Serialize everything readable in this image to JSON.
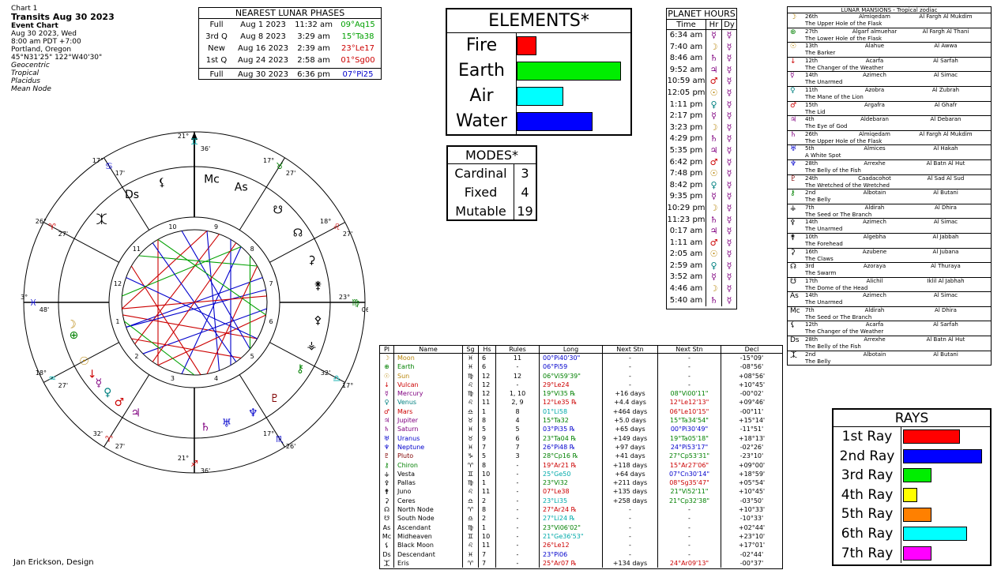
{
  "header": {
    "chart_label": "Chart 1",
    "title": "Transits Aug 30 2023",
    "chart_type": "Event Chart",
    "date": "Aug 30 2023, Wed",
    "time": "8:00 am  PDT +7:00",
    "place": "Portland, Oregon",
    "coords": "45°N31'25\"  122°W40'30\"",
    "settings": [
      "Geocentric",
      "Tropical",
      "Placidus",
      "Mean Node"
    ]
  },
  "lunar_phases": {
    "title": "NEAREST LUNAR PHASES",
    "rows": [
      {
        "phase": "Full",
        "date": "Aug 1 2023",
        "time": "11:32 am",
        "pos": "09°Aq15",
        "color": "#00a000"
      },
      {
        "phase": "3rd Q",
        "date": "Aug 8 2023",
        "time": "3:29 am",
        "pos": "15°Ta38",
        "color": "#00a000"
      },
      {
        "phase": "New",
        "date": "Aug 16 2023",
        "time": "2:39 am",
        "pos": "23°Le17",
        "color": "#cc0000"
      },
      {
        "phase": "1st Q",
        "date": "Aug 24 2023",
        "time": "2:58 am",
        "pos": "01°Sg00",
        "color": "#cc0000"
      },
      {
        "phase": "Full",
        "date": "Aug 30 2023",
        "time": "6:36 pm",
        "pos": "07°Pi25",
        "color": "#0000cc"
      }
    ]
  },
  "elements": {
    "title": "ELEMENTS*",
    "items": [
      {
        "label": "Fire",
        "value": 0.19,
        "color": "#ff0000"
      },
      {
        "label": "Earth",
        "value": 1.0,
        "color": "#00ee00"
      },
      {
        "label": "Air",
        "value": 0.45,
        "color": "#00ffff"
      },
      {
        "label": "Water",
        "value": 0.73,
        "color": "#0000ff"
      }
    ]
  },
  "modes": {
    "title": "MODES*",
    "items": [
      {
        "label": "Cardinal",
        "value": "3"
      },
      {
        "label": "Fixed",
        "value": "4"
      },
      {
        "label": "Mutable",
        "value": "19"
      }
    ]
  },
  "planet_hours": {
    "title": "PLANET HOURS",
    "headers": [
      "Time",
      "Hr",
      "Dy"
    ],
    "rows": [
      {
        "time": "6:34 am",
        "hr": "☿",
        "hc": "#800080",
        "dy": "☿",
        "dc": "#800080"
      },
      {
        "time": "7:40 am",
        "hr": "☽",
        "hc": "#b8860b",
        "dy": "☿",
        "dc": "#800080"
      },
      {
        "time": "8:46 am",
        "hr": "♄",
        "hc": "#800080",
        "dy": "☿",
        "dc": "#800080"
      },
      {
        "time": "9:52 am",
        "hr": "♃",
        "hc": "#800080",
        "dy": "☿",
        "dc": "#800080"
      },
      {
        "time": "10:59 am",
        "hr": "♂",
        "hc": "#cc0000",
        "dy": "☿",
        "dc": "#800080"
      },
      {
        "time": "12:05 pm",
        "hr": "☉",
        "hc": "#b8860b",
        "dy": "☿",
        "dc": "#800080"
      },
      {
        "time": "1:11 pm",
        "hr": "♀",
        "hc": "#008080",
        "dy": "☿",
        "dc": "#800080"
      },
      {
        "time": "2:17 pm",
        "hr": "☿",
        "hc": "#800080",
        "dy": "☿",
        "dc": "#800080"
      },
      {
        "time": "3:23 pm",
        "hr": "☽",
        "hc": "#b8860b",
        "dy": "☿",
        "dc": "#800080"
      },
      {
        "time": "4:29 pm",
        "hr": "♄",
        "hc": "#800080",
        "dy": "☿",
        "dc": "#800080"
      },
      {
        "time": "5:35 pm",
        "hr": "♃",
        "hc": "#800080",
        "dy": "☿",
        "dc": "#800080"
      },
      {
        "time": "6:42 pm",
        "hr": "♂",
        "hc": "#cc0000",
        "dy": "☿",
        "dc": "#800080"
      },
      {
        "time": "7:48 pm",
        "hr": "☉",
        "hc": "#b8860b",
        "dy": "☿",
        "dc": "#800080"
      },
      {
        "time": "8:42 pm",
        "hr": "♀",
        "hc": "#008080",
        "dy": "☿",
        "dc": "#800080"
      },
      {
        "time": "9:35 pm",
        "hr": "☿",
        "hc": "#800080",
        "dy": "☿",
        "dc": "#800080"
      },
      {
        "time": "10:29 pm",
        "hr": "☽",
        "hc": "#b8860b",
        "dy": "☿",
        "dc": "#800080"
      },
      {
        "time": "11:23 pm",
        "hr": "♄",
        "hc": "#800080",
        "dy": "☿",
        "dc": "#800080"
      },
      {
        "time": "0:17 am",
        "hr": "♃",
        "hc": "#800080",
        "dy": "☿",
        "dc": "#800080"
      },
      {
        "time": "1:11 am",
        "hr": "♂",
        "hc": "#cc0000",
        "dy": "☿",
        "dc": "#800080"
      },
      {
        "time": "2:05 am",
        "hr": "☉",
        "hc": "#b8860b",
        "dy": "☿",
        "dc": "#800080"
      },
      {
        "time": "2:59 am",
        "hr": "♀",
        "hc": "#008080",
        "dy": "☿",
        "dc": "#800080"
      },
      {
        "time": "3:52 am",
        "hr": "☿",
        "hc": "#800080",
        "dy": "☿",
        "dc": "#800080"
      },
      {
        "time": "4:46 am",
        "hr": "☽",
        "hc": "#b8860b",
        "dy": "☿",
        "dc": "#800080"
      },
      {
        "time": "5:40 am",
        "hr": "♄",
        "hc": "#800080",
        "dy": "☿",
        "dc": "#800080"
      }
    ]
  },
  "mansions": {
    "title": "LUNAR MANSIONS - Tropical zodiac",
    "rows": [
      {
        "g": "☽",
        "gc": "#b8860b",
        "num": "26th",
        "n1": "Almiqedam",
        "n2": "Al Fargh Al Mukdim",
        "desc": "The Upper Hole of the Flask"
      },
      {
        "g": "⊕",
        "gc": "#008000",
        "num": "27th",
        "n1": "Algarf almuehar",
        "n2": "Al Fargh Al Thani",
        "desc": "The Lower Hole of the Flask"
      },
      {
        "g": "☉",
        "gc": "#b8860b",
        "num": "13th",
        "n1": "Alahue",
        "n2": "Al Awwa",
        "desc": "The Barker"
      },
      {
        "g": "↓",
        "gc": "#cc0000",
        "num": "12th",
        "n1": "Acarfa",
        "n2": "Al Sarfah",
        "desc": "The Changer of the Weather"
      },
      {
        "g": "☿",
        "gc": "#800080",
        "num": "14th",
        "n1": "Azimech",
        "n2": "Al Simac",
        "desc": "The Unarmed"
      },
      {
        "g": "♀",
        "gc": "#008080",
        "num": "11th",
        "n1": "Azobra",
        "n2": "Al Zubrah",
        "desc": "The Mane of the Lion"
      },
      {
        "g": "♂",
        "gc": "#cc0000",
        "num": "15th",
        "n1": "Argafra",
        "n2": "Al Ghafr",
        "desc": "The Lid"
      },
      {
        "g": "♃",
        "gc": "#800080",
        "num": "4th",
        "n1": "Aldebaran",
        "n2": "Al Debaran",
        "desc": "The Eye of God"
      },
      {
        "g": "♄",
        "gc": "#800080",
        "num": "26th",
        "n1": "Almiqedam",
        "n2": "Al Fargh Al Mukdim",
        "desc": "The Upper Hole of the Flask"
      },
      {
        "g": "♅",
        "gc": "#0000cc",
        "num": "5th",
        "n1": "Almices",
        "n2": "Al Hakah",
        "desc": "A White Spot"
      },
      {
        "g": "♆",
        "gc": "#0000cc",
        "num": "28th",
        "n1": "Arrexhe",
        "n2": "Al Batn Al Hut",
        "desc": "The Belly of the Fish"
      },
      {
        "g": "♇",
        "gc": "#800000",
        "num": "24th",
        "n1": "Caadacohot",
        "n2": "Al Sad Al Sud",
        "desc": "The Wretched of the Wretched"
      },
      {
        "g": "⚷",
        "gc": "#008000",
        "num": "2nd",
        "n1": "Albotain",
        "n2": "Al Butani",
        "desc": "The Belly"
      },
      {
        "g": "⚶",
        "gc": "#000000",
        "num": "7th",
        "n1": "Aldirah",
        "n2": "Al Dhira",
        "desc": "The Seed or The Branch"
      },
      {
        "g": "⚴",
        "gc": "#000000",
        "num": "14th",
        "n1": "Azimech",
        "n2": "Al Simac",
        "desc": "The Unarmed"
      },
      {
        "g": "⚵",
        "gc": "#000000",
        "num": "10th",
        "n1": "Algebha",
        "n2": "Al Jabbah",
        "desc": "The Forehead"
      },
      {
        "g": "⚳",
        "gc": "#000000",
        "num": "16th",
        "n1": "Azubene",
        "n2": "Al Jubana",
        "desc": "The Claws"
      },
      {
        "g": "☊",
        "gc": "#000000",
        "num": "3rd",
        "n1": "Azoraya",
        "n2": "Al Thuraya",
        "desc": "The Swarm"
      },
      {
        "g": "☋",
        "gc": "#000000",
        "num": "17th",
        "n1": "Alichil",
        "n2": "Iklil Al Jabhah",
        "desc": "The Dome of the Head"
      },
      {
        "g": "As",
        "gc": "#000000",
        "num": "14th",
        "n1": "Azimech",
        "n2": "Al Simac",
        "desc": "The Unarmed"
      },
      {
        "g": "Mc",
        "gc": "#000000",
        "num": "7th",
        "n1": "Aldirah",
        "n2": "Al Dhira",
        "desc": "The Seed or The Branch"
      },
      {
        "g": "⚸",
        "gc": "#000000",
        "num": "12th",
        "n1": "Acarfa",
        "n2": "Al Sarfah",
        "desc": "The Changer of the Weather"
      },
      {
        "g": "Ds",
        "gc": "#000000",
        "num": "28th",
        "n1": "Arrexhe",
        "n2": "Al Batn Al Hut",
        "desc": "The Belly of the Fish"
      },
      {
        "g": "⯰",
        "gc": "#000000",
        "num": "2nd",
        "n1": "Albotain",
        "n2": "Al Butani",
        "desc": "The Belly"
      }
    ]
  },
  "rays": {
    "title": "RAYS",
    "items": [
      {
        "label": "1st Ray",
        "value": 0.72,
        "color": "#ff0000"
      },
      {
        "label": "2nd Ray",
        "value": 1.0,
        "color": "#0000ff"
      },
      {
        "label": "3rd Ray",
        "value": 0.36,
        "color": "#00ee00"
      },
      {
        "label": "4th Ray",
        "value": 0.18,
        "color": "#ffff00"
      },
      {
        "label": "5th Ray",
        "value": 0.36,
        "color": "#ff8000"
      },
      {
        "label": "6th Ray",
        "value": 0.81,
        "color": "#00ffff"
      },
      {
        "label": "7th Ray",
        "value": 0.36,
        "color": "#ff00ff"
      }
    ]
  },
  "planet_table": {
    "headers": [
      "Pl",
      "Name",
      "Sg",
      "Hs",
      "Rules",
      "Long",
      "Next Stn",
      "Next Stn",
      "Decl"
    ],
    "rows": [
      {
        "g": "☽",
        "gc": "#b8860b",
        "name": "Moon",
        "nc": "#b8860b",
        "sg": "♓",
        "hs": "6",
        "rules": "11",
        "long": "00°Pi40'30\"",
        "lc": "#0000cc",
        "n1": "-",
        "n2": "-",
        "n2c": "#000",
        "decl": "-15°09'"
      },
      {
        "g": "⊕",
        "gc": "#008000",
        "name": "Earth",
        "nc": "#008000",
        "sg": "♓",
        "hs": "6",
        "rules": "-",
        "long": "06°Pi59",
        "lc": "#0000cc",
        "n1": "-",
        "n2": "-",
        "n2c": "#000",
        "decl": "-08°56'"
      },
      {
        "g": "☉",
        "gc": "#b8860b",
        "name": "Sun",
        "nc": "#b8860b",
        "sg": "♍",
        "hs": "12",
        "rules": "12",
        "long": "06°Vi59'39\"",
        "lc": "#008000",
        "n1": "-",
        "n2": "-",
        "n2c": "#000",
        "decl": "+08°56'"
      },
      {
        "g": "↓",
        "gc": "#cc0000",
        "name": "Vulcan",
        "nc": "#cc0000",
        "sg": "♌",
        "hs": "12",
        "rules": "-",
        "long": "29°Le24",
        "lc": "#cc0000",
        "n1": "-",
        "n2": "-",
        "n2c": "#000",
        "decl": "+10°45'"
      },
      {
        "g": "☿",
        "gc": "#800080",
        "name": "Mercury",
        "nc": "#800080",
        "sg": "♍",
        "hs": "12",
        "rules": "1, 10",
        "long": "19°Vi35 ℞",
        "lc": "#008000",
        "n1": "+16 days",
        "n2": "08°Vi00'11\"",
        "n2c": "#008000",
        "decl": "-00°02'"
      },
      {
        "g": "♀",
        "gc": "#008080",
        "name": "Venus",
        "nc": "#008080",
        "sg": "♌",
        "hs": "11",
        "rules": "2, 9",
        "long": "12°Le35 ℞",
        "lc": "#cc0000",
        "n1": "+4.4 days",
        "n2": "12°Le12'13\"",
        "n2c": "#cc0000",
        "decl": "+09°46'"
      },
      {
        "g": "♂",
        "gc": "#cc0000",
        "name": "Mars",
        "nc": "#cc0000",
        "sg": "♎",
        "hs": "1",
        "rules": "8",
        "long": "01°Li58",
        "lc": "#00aaaa",
        "n1": "+464 days",
        "n2": "06°Le10'15\"",
        "n2c": "#cc0000",
        "decl": "-00°11'"
      },
      {
        "g": "♃",
        "gc": "#800080",
        "name": "Jupiter",
        "nc": "#800080",
        "sg": "♉",
        "hs": "8",
        "rules": "4",
        "long": "15°Ta32",
        "lc": "#008000",
        "n1": "+5.0 days",
        "n2": "15°Ta34'54\"",
        "n2c": "#008000",
        "decl": "+15°14'"
      },
      {
        "g": "♄",
        "gc": "#800080",
        "name": "Saturn",
        "nc": "#800080",
        "sg": "♓",
        "hs": "5",
        "rules": "5",
        "long": "03°Pi35 ℞",
        "lc": "#0000cc",
        "n1": "+65 days",
        "n2": "00°Pi30'49\"",
        "n2c": "#0000cc",
        "decl": "-11°51'"
      },
      {
        "g": "♅",
        "gc": "#0000cc",
        "name": "Uranus",
        "nc": "#0000cc",
        "sg": "♉",
        "hs": "9",
        "rules": "6",
        "long": "23°Ta04 ℞",
        "lc": "#008000",
        "n1": "+149 days",
        "n2": "19°Ta05'18\"",
        "n2c": "#008000",
        "decl": "+18°13'"
      },
      {
        "g": "♆",
        "gc": "#0000cc",
        "name": "Neptune",
        "nc": "#0000cc",
        "sg": "♓",
        "hs": "7",
        "rules": "7",
        "long": "26°Pi48 ℞",
        "lc": "#0000cc",
        "n1": "+97 days",
        "n2": "24°Pi53'17\"",
        "n2c": "#0000cc",
        "decl": "-02°26'"
      },
      {
        "g": "♇",
        "gc": "#800000",
        "name": "Pluto",
        "nc": "#800000",
        "sg": "♑",
        "hs": "5",
        "rules": "3",
        "long": "28°Cp16 ℞",
        "lc": "#008000",
        "n1": "+41 days",
        "n2": "27°Cp53'31\"",
        "n2c": "#008000",
        "decl": "-23°10'"
      },
      {
        "g": "⚷",
        "gc": "#008000",
        "name": "Chiron",
        "nc": "#008000",
        "sg": "♈",
        "hs": "8",
        "rules": "-",
        "long": "19°Ar21 ℞",
        "lc": "#cc0000",
        "n1": "+118 days",
        "n2": "15°Ar27'06\"",
        "n2c": "#cc0000",
        "decl": "+09°00'"
      },
      {
        "g": "⚶",
        "gc": "#000000",
        "name": "Vesta",
        "nc": "#000000",
        "sg": "♊",
        "hs": "10",
        "rules": "-",
        "long": "25°Ge50",
        "lc": "#00aaaa",
        "n1": "+64 days",
        "n2": "07°Cn30'14\"",
        "n2c": "#0000cc",
        "decl": "+18°59'"
      },
      {
        "g": "⚴",
        "gc": "#000000",
        "name": "Pallas",
        "nc": "#000000",
        "sg": "♍",
        "hs": "1",
        "rules": "-",
        "long": "23°Vi32",
        "lc": "#008000",
        "n1": "+211 days",
        "n2": "08°Sg35'47\"",
        "n2c": "#cc0000",
        "decl": "+05°54'"
      },
      {
        "g": "⚵",
        "gc": "#000000",
        "name": "Juno",
        "nc": "#000000",
        "sg": "♌",
        "hs": "11",
        "rules": "-",
        "long": "07°Le38",
        "lc": "#cc0000",
        "n1": "+135 days",
        "n2": "21°Vi52'11\"",
        "n2c": "#008000",
        "decl": "+10°45'"
      },
      {
        "g": "⚳",
        "gc": "#000000",
        "name": "Ceres",
        "nc": "#000000",
        "sg": "♎",
        "hs": "2",
        "rules": "-",
        "long": "23°Li35",
        "lc": "#00aaaa",
        "n1": "+258 days",
        "n2": "21°Cp32'38\"",
        "n2c": "#008000",
        "decl": "-03°50'"
      },
      {
        "g": "☊",
        "gc": "#000000",
        "name": "North Node",
        "nc": "#000000",
        "sg": "♈",
        "hs": "8",
        "rules": "-",
        "long": "27°Ar24 ℞",
        "lc": "#cc0000",
        "n1": "-",
        "n2": "-",
        "n2c": "#000",
        "decl": "+10°33'"
      },
      {
        "g": "☋",
        "gc": "#000000",
        "name": "South Node",
        "nc": "#000000",
        "sg": "♎",
        "hs": "2",
        "rules": "-",
        "long": "27°Li24 ℞",
        "lc": "#00aaaa",
        "n1": "-",
        "n2": "-",
        "n2c": "#000",
        "decl": "-10°33'"
      },
      {
        "g": "As",
        "gc": "#000000",
        "name": "Ascendant",
        "nc": "#000000",
        "sg": "♍",
        "hs": "1",
        "rules": "-",
        "long": "23°Vi06'02\"",
        "lc": "#008000",
        "n1": "-",
        "n2": "-",
        "n2c": "#000",
        "decl": "+02°44'"
      },
      {
        "g": "Mc",
        "gc": "#000000",
        "name": "Midheaven",
        "nc": "#000000",
        "sg": "♊",
        "hs": "10",
        "rules": "-",
        "long": "21°Ge36'53\"",
        "lc": "#00aaaa",
        "n1": "-",
        "n2": "-",
        "n2c": "#000",
        "decl": "+23°10'"
      },
      {
        "g": "⚸",
        "gc": "#000000",
        "name": "Black Moon",
        "nc": "#000000",
        "sg": "♌",
        "hs": "11",
        "rules": "-",
        "long": "26°Le12",
        "lc": "#cc0000",
        "n1": "-",
        "n2": "-",
        "n2c": "#000",
        "decl": "+17°01'"
      },
      {
        "g": "Ds",
        "gc": "#000000",
        "name": "Descendant",
        "nc": "#000000",
        "sg": "♓",
        "hs": "7",
        "rules": "-",
        "long": "23°Pi06",
        "lc": "#0000cc",
        "n1": "-",
        "n2": "-",
        "n2c": "#000",
        "decl": "-02°44'"
      },
      {
        "g": "⯰",
        "gc": "#000000",
        "name": "Eris",
        "nc": "#000000",
        "sg": "♈",
        "hs": "7",
        "rules": "-",
        "long": "25°Ar07 ℞",
        "lc": "#cc0000",
        "n1": "+134 days",
        "n2": "24°Ar09'13\"",
        "n2c": "#cc0000",
        "decl": "-00°37'"
      }
    ]
  },
  "wheel": {
    "cusp_labels": [
      {
        "deg": "21°",
        "sign": "♊",
        "min": "36'",
        "color": "#00aaaa"
      },
      {
        "deg": "17°",
        "sign": "♋",
        "min": "17'",
        "color": "#0000cc"
      },
      {
        "deg": "26°",
        "sign": "♈",
        "min": "27'",
        "color": "#cc0000"
      },
      {
        "deg": "23°",
        "sign": "♓",
        "min": "48'",
        "color": "#0000cc"
      },
      {
        "deg": "18°",
        "sign": "♒",
        "min": "27'",
        "color": "#00aaaa"
      },
      {
        "deg": "21°",
        "sign": "♐",
        "min": "36'",
        "color": "#cc0000"
      },
      {
        "deg": "17°",
        "sign": "♏",
        "min": "26'",
        "color": "#0000cc"
      },
      {
        "deg": "32'",
        "sign": "♎",
        "min": "17°",
        "color": "#00aaaa"
      },
      {
        "deg": "23°",
        "sign": "♍",
        "min": "06'",
        "color": "#008000"
      },
      {
        "deg": "18°",
        "sign": "♌",
        "min": "27'",
        "color": "#cc0000"
      },
      {
        "deg": "17°",
        "sign": "♉",
        "min": "27'",
        "color": "#008000"
      },
      {
        "deg": "32'",
        "sign": "♈",
        "min": "27'",
        "color": "#cc0000"
      }
    ],
    "house_numbers": [
      "1",
      "2",
      "3",
      "4",
      "5",
      "6",
      "7",
      "8",
      "9",
      "10",
      "11",
      "12"
    ]
  },
  "footer": "Jan Erickson, Design"
}
